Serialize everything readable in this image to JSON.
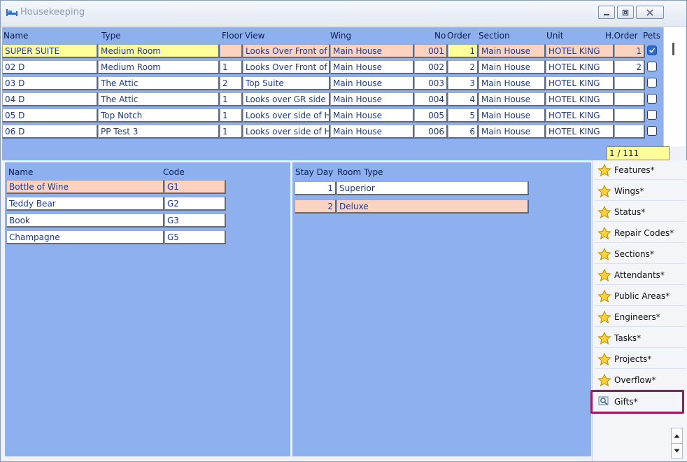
{
  "window": {
    "title": "Housekeeping"
  },
  "rooms": {
    "headers": {
      "name": "Name",
      "type": "Type",
      "floor": "Floor",
      "view": "View",
      "wing": "Wing",
      "no": "No",
      "order": "Order",
      "section": "Section",
      "unit": "Unit",
      "horder": "H.Order",
      "pets": "Pets"
    },
    "rows": [
      {
        "name": "SUPER SUITE",
        "type": "Medium Room",
        "floor": "",
        "view": "Looks Over Front of",
        "wing": "Main House",
        "no": "001",
        "order": "1",
        "section": "Main House",
        "unit": "HOTEL KING",
        "horder": "1",
        "pets": true
      },
      {
        "name": "02 D",
        "type": "Medium Room",
        "floor": "1",
        "view": "Looks Over Front of",
        "wing": "Main House",
        "no": "002",
        "order": "2",
        "section": "Main House",
        "unit": "HOTEL KING",
        "horder": "2",
        "pets": false
      },
      {
        "name": "03 D",
        "type": "The Attic",
        "floor": "2",
        "view": "Top Suite",
        "wing": "Main House",
        "no": "003",
        "order": "3",
        "section": "Main House",
        "unit": "HOTEL KING",
        "horder": "",
        "pets": false
      },
      {
        "name": "04 D",
        "type": "The Attic",
        "floor": "1",
        "view": "Looks over GR side",
        "wing": "Main House",
        "no": "004",
        "order": "4",
        "section": "Main House",
        "unit": "HOTEL KING",
        "horder": "",
        "pets": false
      },
      {
        "name": "05 D",
        "type": "Top Notch",
        "floor": "1",
        "view": "Looks over side of H",
        "wing": "Main House",
        "no": "005",
        "order": "5",
        "section": "Main House",
        "unit": "HOTEL KING",
        "horder": "",
        "pets": false
      },
      {
        "name": "06 D",
        "type": "PP Test 3",
        "floor": "1",
        "view": "Looks over side of H",
        "wing": "Main House",
        "no": "006",
        "order": "6",
        "section": "Main House",
        "unit": "HOTEL KING",
        "horder": "",
        "pets": false
      }
    ],
    "counter": "1 / 111"
  },
  "gifts": {
    "headers": {
      "name": "Name",
      "code": "Code"
    },
    "rows": [
      {
        "name": "Bottle of Wine",
        "code": "G1"
      },
      {
        "name": "Teddy Bear",
        "code": "G2"
      },
      {
        "name": "Book",
        "code": "G3"
      },
      {
        "name": "Champagne",
        "code": "G5"
      }
    ]
  },
  "stays": {
    "headers": {
      "stay_day": "Stay Day",
      "room_type": "Room Type"
    },
    "rows": [
      {
        "day": "1",
        "room_type": "Superior"
      },
      {
        "day": "2",
        "room_type": "Deluxe"
      }
    ]
  },
  "sidebar": {
    "items": [
      {
        "label": "Features*",
        "icon": "star-icon"
      },
      {
        "label": "Wings*",
        "icon": "star-icon"
      },
      {
        "label": "Status*",
        "icon": "star-icon"
      },
      {
        "label": "Repair Codes*",
        "icon": "star-icon"
      },
      {
        "label": "Sections*",
        "icon": "star-icon"
      },
      {
        "label": "Attendants*",
        "icon": "star-icon"
      },
      {
        "label": "Public Areas*",
        "icon": "star-icon"
      },
      {
        "label": "Engineers*",
        "icon": "star-icon"
      },
      {
        "label": "Tasks*",
        "icon": "star-icon"
      },
      {
        "label": "Projects*",
        "icon": "star-icon"
      },
      {
        "label": "Overflow*",
        "icon": "star-icon"
      },
      {
        "label": "Gifts*",
        "icon": "search-icon"
      }
    ]
  },
  "colors": {
    "panel": "#8fb0ef",
    "selected_row": "#ffff99",
    "alt_row": "#fcd2c0",
    "highlight": "#a1175a"
  }
}
